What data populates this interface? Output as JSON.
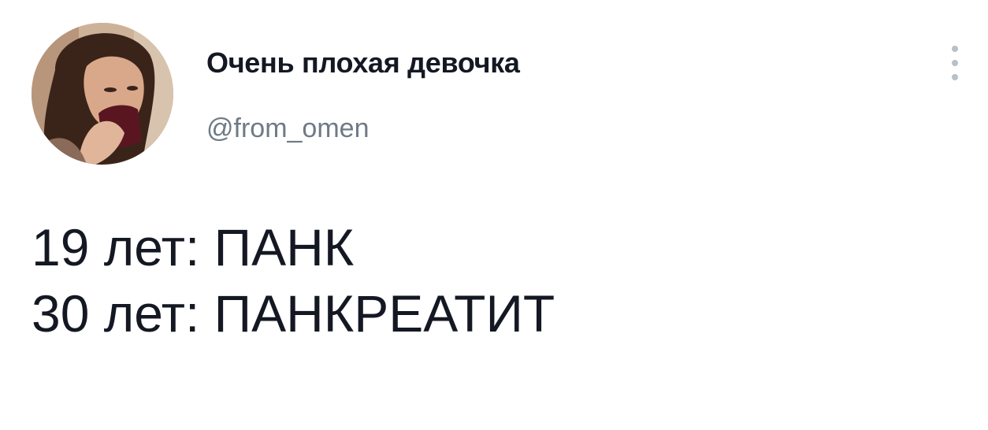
{
  "author": {
    "display_name": "Очень плохая девочка",
    "handle": "@from_omen"
  },
  "tweet": {
    "lines": [
      "19 лет: ПАНК",
      "30 лет: ПАНКРЕАТИТ"
    ]
  },
  "icons": {
    "more": "more-vertical-icon",
    "avatar": "avatar-photo"
  },
  "colors": {
    "text": "#141823",
    "handle": "#6e7a86",
    "menu_dots": "#b8c0c8",
    "background": "#ffffff"
  }
}
